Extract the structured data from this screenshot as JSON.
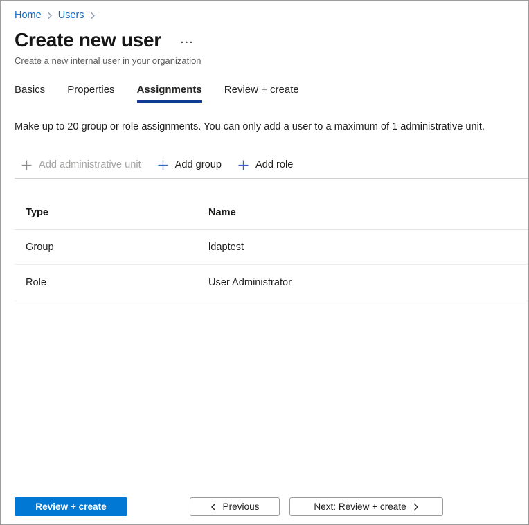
{
  "colors": {
    "link_blue": "#0f6ac4",
    "primary_blue": "#0078d4",
    "active_tab_underline": "#123b94",
    "text_dark": "#1f1e1d",
    "text_gray": "#5c5b5a",
    "disabled_gray": "#a6a4a2",
    "divider": "#ececec",
    "toolbar_divider": "#d2d0ce",
    "button_border": "#9d9b99"
  },
  "icons": {
    "chevron_right": "›",
    "chevron_left": "‹",
    "plus": "+",
    "ellipsis_horizontal": "···"
  },
  "breadcrumb": {
    "items": [
      {
        "label": "Home"
      },
      {
        "label": "Users"
      }
    ]
  },
  "header": {
    "title": "Create new user",
    "subtitle": "Create a new internal user in your organization"
  },
  "tabs": [
    {
      "label": "Basics",
      "active": false
    },
    {
      "label": "Properties",
      "active": false
    },
    {
      "label": "Assignments",
      "active": true
    },
    {
      "label": "Review + create",
      "active": false
    }
  ],
  "description": "Make up to 20 group or role assignments. You can only add a user to a maximum of 1 administrative unit.",
  "toolbar": {
    "items": [
      {
        "label": "Add administrative unit",
        "disabled": true
      },
      {
        "label": "Add group",
        "disabled": false
      },
      {
        "label": "Add role",
        "disabled": false
      }
    ]
  },
  "table": {
    "columns": [
      "Type",
      "Name"
    ],
    "rows": [
      {
        "type": "Group",
        "name": "ldaptest"
      },
      {
        "type": "Role",
        "name": "User Administrator"
      }
    ]
  },
  "footer": {
    "primary_button": "Review + create",
    "previous_button": "Previous",
    "next_button": "Next: Review + create"
  }
}
